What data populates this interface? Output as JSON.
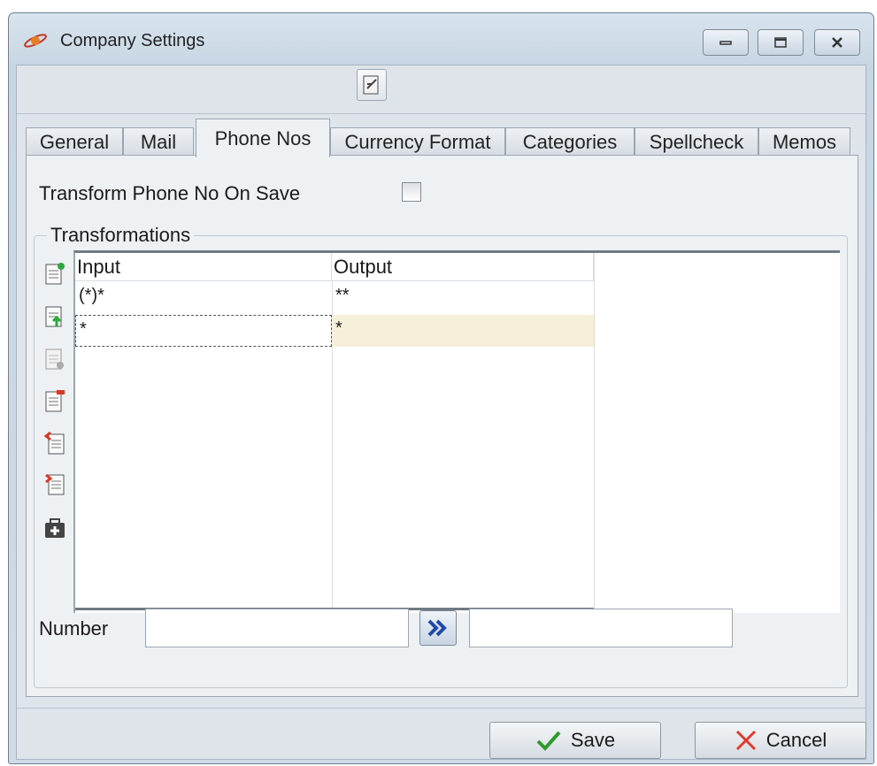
{
  "window": {
    "title": "Company Settings"
  },
  "tabs": [
    {
      "label": "General"
    },
    {
      "label": "Mail"
    },
    {
      "label": "Phone Nos"
    },
    {
      "label": "Currency Format"
    },
    {
      "label": "Categories"
    },
    {
      "label": "Spellcheck"
    },
    {
      "label": "Memos"
    }
  ],
  "active_tab": "Phone Nos",
  "phone": {
    "transform_label": "Transform Phone No On Save",
    "transform_checked": false,
    "group_title": "Transformations",
    "columns": {
      "input": "Input",
      "output": "Output"
    },
    "rows": [
      {
        "input": "(*)*",
        "output": "**"
      },
      {
        "input": "*",
        "output": "*"
      }
    ],
    "number_label": "Number",
    "number_value": "",
    "result_value": ""
  },
  "side_tools": [
    "insert-row-icon",
    "add-row-icon",
    "copy-row-icon",
    "delete-row-icon",
    "move-up-icon",
    "move-down-icon",
    "toolkit-icon"
  ],
  "buttons": {
    "save": "Save",
    "cancel": "Cancel"
  },
  "colors": {
    "selected_row": "#f6f0d9",
    "save_check": "#2e9a2e",
    "cancel_x": "#e23b2e",
    "go_arrow": "#1f4aa8"
  }
}
